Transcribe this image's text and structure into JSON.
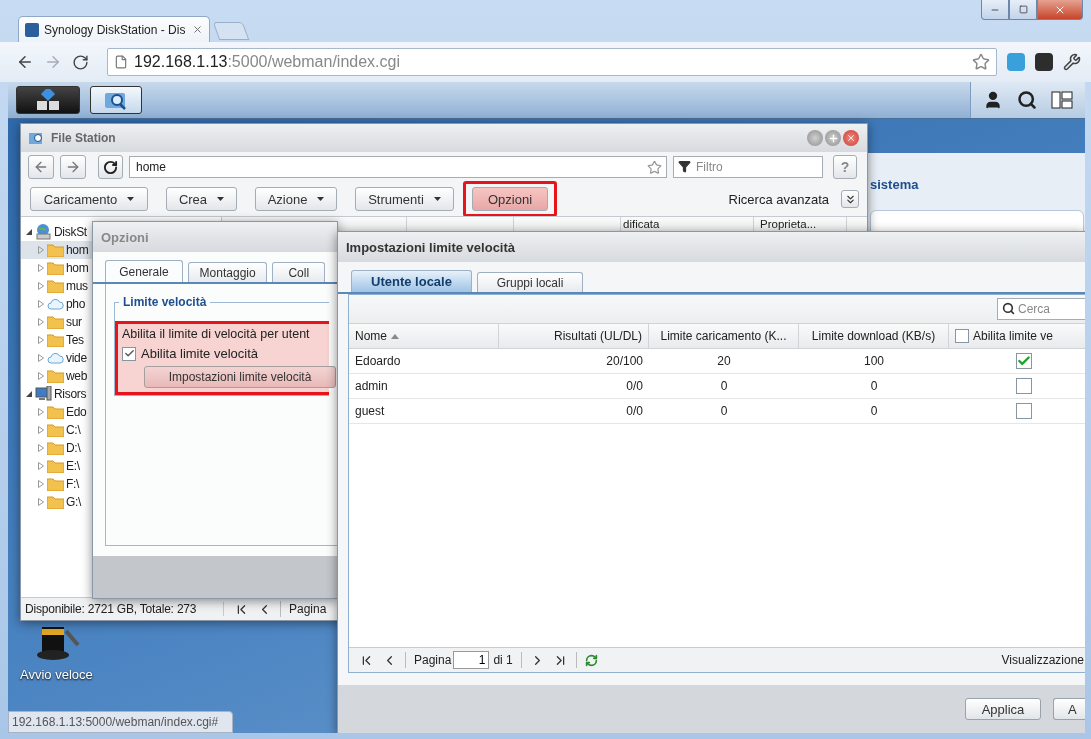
{
  "browser": {
    "tab_title": "Synology DiskStation - Dis",
    "url_host": "192.168.1.13",
    "url_path": ":5000/webman/index.cgi",
    "status_url": "192.168.1.13:5000/webman/index.cgi#"
  },
  "taskbar": {
    "apps": [
      {
        "kind": "main-menu",
        "selected": false
      },
      {
        "kind": "file-station",
        "selected": true
      }
    ]
  },
  "widget": {
    "title": "sistema"
  },
  "desktop_shortcut": {
    "label": "Avvio veloce"
  },
  "file_station": {
    "title": "File Station",
    "path": "home",
    "filter_placeholder": "Filtro",
    "help": "?",
    "toolbar": [
      {
        "label": "Caricamento",
        "dropdown": true,
        "highlighted": false
      },
      {
        "label": "Crea",
        "dropdown": true,
        "highlighted": false
      },
      {
        "label": "Azione",
        "dropdown": true,
        "highlighted": false
      },
      {
        "label": "Strumenti",
        "dropdown": true,
        "highlighted": false
      },
      {
        "label": "Opzioni",
        "dropdown": false,
        "highlighted": true
      }
    ],
    "advanced_search": "Ricerca avanzata",
    "columns": [
      "dificata",
      "Proprieta..."
    ],
    "tree": [
      {
        "label": "DiskSt",
        "kind": "nas",
        "expanded": true,
        "selected": false,
        "children": [
          {
            "label": "hom",
            "kind": "folder",
            "expanded": false,
            "selected": true
          },
          {
            "label": "hom",
            "kind": "folder",
            "expanded": false,
            "selected": false
          },
          {
            "label": "mus",
            "kind": "folder",
            "expanded": false,
            "selected": false
          },
          {
            "label": "pho",
            "kind": "cloud",
            "expanded": false,
            "selected": false
          },
          {
            "label": "sur",
            "kind": "folder",
            "expanded": false,
            "selected": false
          },
          {
            "label": "Tes",
            "kind": "folder",
            "expanded": false,
            "selected": false
          },
          {
            "label": "vide",
            "kind": "cloud",
            "expanded": false,
            "selected": false
          },
          {
            "label": "web",
            "kind": "folder",
            "expanded": false,
            "selected": false
          }
        ]
      },
      {
        "label": "Risors",
        "kind": "computer",
        "expanded": true,
        "selected": false,
        "children": [
          {
            "label": "Edo",
            "kind": "folder",
            "expanded": false,
            "selected": false
          },
          {
            "label": "C:\\",
            "kind": "folder",
            "expanded": false,
            "selected": false
          },
          {
            "label": "D:\\",
            "kind": "folder",
            "expanded": false,
            "selected": false
          },
          {
            "label": "E:\\",
            "kind": "folder",
            "expanded": false,
            "selected": false
          },
          {
            "label": "F:\\",
            "kind": "folder",
            "expanded": false,
            "selected": false
          },
          {
            "label": "G:\\",
            "kind": "folder",
            "expanded": false,
            "selected": false
          }
        ]
      }
    ],
    "status": "Disponibile: 2721 GB, Totale: 273",
    "pager_label": "Pagina"
  },
  "options_dialog": {
    "title": "Opzioni",
    "tabs": [
      {
        "label": "Generale",
        "selected": true
      },
      {
        "label": "Montaggio",
        "selected": false
      },
      {
        "label": "Coll",
        "selected": false
      }
    ],
    "section": "Limite velocità",
    "description": "Abilita il limite di velocità per utent",
    "checkbox": {
      "label": "Abilita limite velocità",
      "checked": true
    },
    "button": "Impostazioni limite velocità",
    "highlighted": true
  },
  "speed_dialog": {
    "title": "Impostazioni limite velocità",
    "tabs": [
      {
        "label": "Utente locale",
        "selected": true
      },
      {
        "label": "Gruppi locali",
        "selected": false
      }
    ],
    "search_placeholder": "Cerca",
    "columns": [
      {
        "label": "Nome",
        "kind": "text",
        "sorted": true
      },
      {
        "label": "Risultati (UL/DL)",
        "kind": "text",
        "sorted": false
      },
      {
        "label": "Limite caricamento (K...",
        "kind": "text",
        "sorted": false
      },
      {
        "label": "Limite download (KB/s)",
        "kind": "text",
        "sorted": false
      },
      {
        "label": "Abilita limite ve",
        "kind": "checkbox",
        "sorted": false,
        "checked": false
      }
    ],
    "rows": [
      {
        "name": "Edoardo",
        "result": "20/100",
        "upload": "20",
        "download": "100",
        "enabled": true
      },
      {
        "name": "admin",
        "result": "0/0",
        "upload": "0",
        "download": "0",
        "enabled": false
      },
      {
        "name": "guest",
        "result": "0/0",
        "upload": "0",
        "download": "0",
        "enabled": false
      }
    ],
    "pager": {
      "label": "Pagina",
      "page": "1",
      "of": "di 1",
      "display": "Visualizzazione"
    },
    "buttons": [
      "Applica",
      "A"
    ]
  }
}
